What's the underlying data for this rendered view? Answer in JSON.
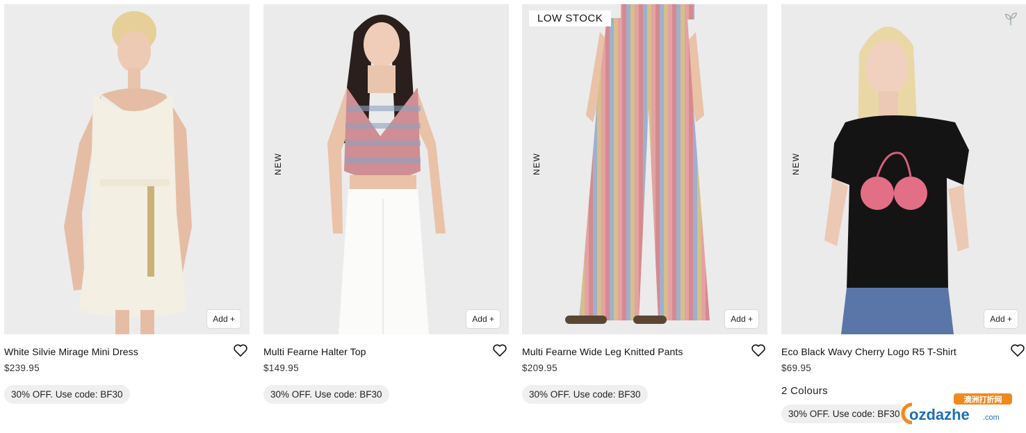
{
  "products": [
    {
      "name": "White Silvie Mirage Mini Dress",
      "price": "$239.95",
      "promo": "30% OFF. Use code: BF30",
      "add_label": "Add +",
      "image_bg": "#ececec"
    },
    {
      "name": "Multi Fearne Halter Top",
      "price": "$149.95",
      "promo": "30% OFF. Use code: BF30",
      "add_label": "Add +",
      "badge": "NEW",
      "image_bg": "#ebebeb"
    },
    {
      "name": "Multi Fearne Wide Leg Knitted Pants",
      "price": "$209.95",
      "promo": "30% OFF. Use code: BF30",
      "add_label": "Add +",
      "badge": "NEW",
      "stock_label": "LOW STOCK",
      "image_bg": "#ebebeb"
    },
    {
      "name": "Eco Black Wavy Cherry Logo R5 T-Shirt",
      "price": "$69.95",
      "colours": "2 Colours",
      "promo": "30% OFF. Use code: BF30",
      "add_label": "Add +",
      "badge": "NEW",
      "image_bg": "#ebebeb"
    }
  ],
  "watermark": {
    "top": "澳洲打折网",
    "main": "ozdazhe",
    "suffix": ".com"
  },
  "colors": {
    "promo_bg": "#efefef",
    "text": "#111111",
    "eco_icon": "#9aa89a"
  },
  "icons": {
    "wishlist": "heart-outline-icon",
    "eco": "sprout-icon"
  }
}
